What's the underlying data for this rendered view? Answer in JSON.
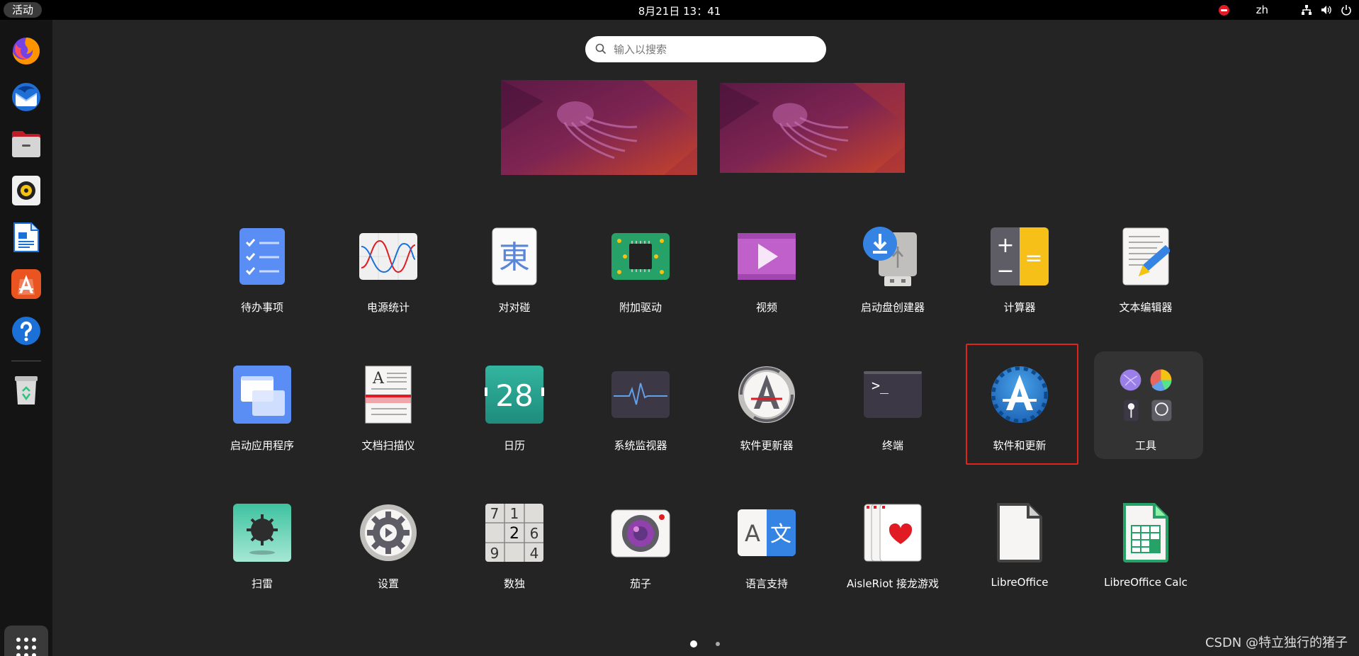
{
  "topbar": {
    "activities_label": "活动",
    "clock": "8月21日  13：41",
    "lang": "zh",
    "icons": [
      "do-not-disturb-icon",
      "network-icon",
      "volume-icon",
      "power-icon"
    ]
  },
  "dock": {
    "items": [
      "firefox-icon",
      "thunderbird-icon",
      "files-icon",
      "rhythmbox-icon",
      "libreoffice-writer-icon",
      "software-icon",
      "help-icon",
      "trash-icon"
    ],
    "show_apps_icon": "grid-icon"
  },
  "search": {
    "placeholder": "输入以搜索"
  },
  "apps": [
    {
      "label": "待办事项",
      "icon": "todo-icon"
    },
    {
      "label": "电源统计",
      "icon": "power-statistics-icon"
    },
    {
      "label": "对对碰",
      "icon": "mahjongg-icon"
    },
    {
      "label": "附加驱动",
      "icon": "additional-drivers-icon"
    },
    {
      "label": "视频",
      "icon": "video-icon"
    },
    {
      "label": "启动盘创建器",
      "icon": "usb-creator-icon"
    },
    {
      "label": "计算器",
      "icon": "calculator-icon"
    },
    {
      "label": "文本编辑器",
      "icon": "text-editor-icon"
    },
    {
      "label": "启动应用程序",
      "icon": "startup-apps-icon"
    },
    {
      "label": "文档扫描仪",
      "icon": "document-scanner-icon"
    },
    {
      "label": "日历",
      "icon": "calendar-icon",
      "day": "28"
    },
    {
      "label": "系统监视器",
      "icon": "system-monitor-icon"
    },
    {
      "label": "软件更新器",
      "icon": "software-updater-icon"
    },
    {
      "label": "终端",
      "icon": "terminal-icon",
      "prompt": ">_"
    },
    {
      "label": "软件和更新",
      "icon": "software-properties-icon"
    },
    {
      "label": "工具",
      "icon": "utilities-folder-icon"
    },
    {
      "label": "扫雷",
      "icon": "mines-icon"
    },
    {
      "label": "设置",
      "icon": "settings-gear-icon"
    },
    {
      "label": "数独",
      "icon": "sudoku-icon",
      "digits": [
        "7",
        "1",
        "2",
        "6",
        "9",
        "4"
      ]
    },
    {
      "label": "茄子",
      "icon": "cheese-camera-icon"
    },
    {
      "label": "语言支持",
      "icon": "language-support-icon",
      "glyphs": [
        "A",
        "文"
      ]
    },
    {
      "label": "AisleRiot 接龙游戏",
      "icon": "aisleriot-cards-icon"
    },
    {
      "label": "LibreOffice",
      "icon": "libreoffice-icon"
    },
    {
      "label": "LibreOffice Calc",
      "icon": "libreoffice-calc-icon"
    }
  ],
  "calculator": {
    "plus": "+",
    "minus": "−",
    "equals": "="
  },
  "scanner_letter": "A",
  "mahjongg_char": "東",
  "pagination": {
    "pages": 2,
    "current": 1
  },
  "watermark": "CSDN @特立独行的猪子",
  "colors": {
    "highlight": "#e0241b",
    "background": "#242424"
  }
}
